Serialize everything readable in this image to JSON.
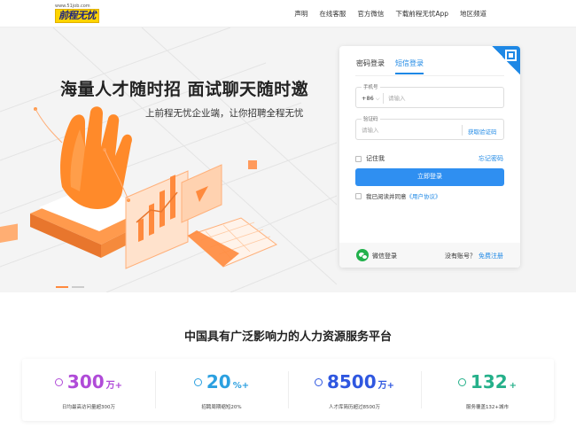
{
  "header": {
    "logo_url_text": "www.51job.com",
    "logo_text": "前程无忧",
    "nav": [
      "声明",
      "在线客服",
      "官方微信",
      "下载前程无忧App",
      "地区频道"
    ]
  },
  "hero": {
    "title": "海量人才随时招 面试聊天随时邀",
    "subtitle": "上前程无忧企业端，让你招聘全程无忧",
    "slide_count": 2,
    "active_slide": 1
  },
  "login": {
    "tabs": [
      {
        "label": "密码登录",
        "active": false
      },
      {
        "label": "短信登录",
        "active": true
      }
    ],
    "phone_field": {
      "label": "手机号",
      "country_code": "+86",
      "placeholder": "请输入"
    },
    "code_field": {
      "label": "验证码",
      "placeholder": "请输入",
      "get_code": "获取验证码"
    },
    "remember_label": "记住我",
    "forgot_label": "忘记密码",
    "submit_label": "立即登录",
    "agree_prefix": "我已阅读并同意",
    "agree_link": "《用户协议》",
    "wechat_label": "微信登录",
    "no_account": "没有账号？",
    "register_label": "免费注册"
  },
  "section_title": "中国具有广泛影响力的人力资源服务平台",
  "stats": [
    {
      "icon": "user-icon",
      "color": "#b04bd8",
      "number": "300",
      "unit": "万+",
      "label": "日均最高访问量超300万"
    },
    {
      "icon": "clock-icon",
      "color": "#2ba0e0",
      "number": "20",
      "unit": "%+",
      "label": "招聘周期缩短20%"
    },
    {
      "icon": "people-icon",
      "color": "#2f57e0",
      "number": "8500",
      "unit": "万+",
      "label": "人才库简历超过8500万"
    },
    {
      "icon": "chat-icon",
      "color": "#25b08a",
      "number": "132",
      "unit": "+",
      "label": "服务覆盖132+城市"
    }
  ]
}
